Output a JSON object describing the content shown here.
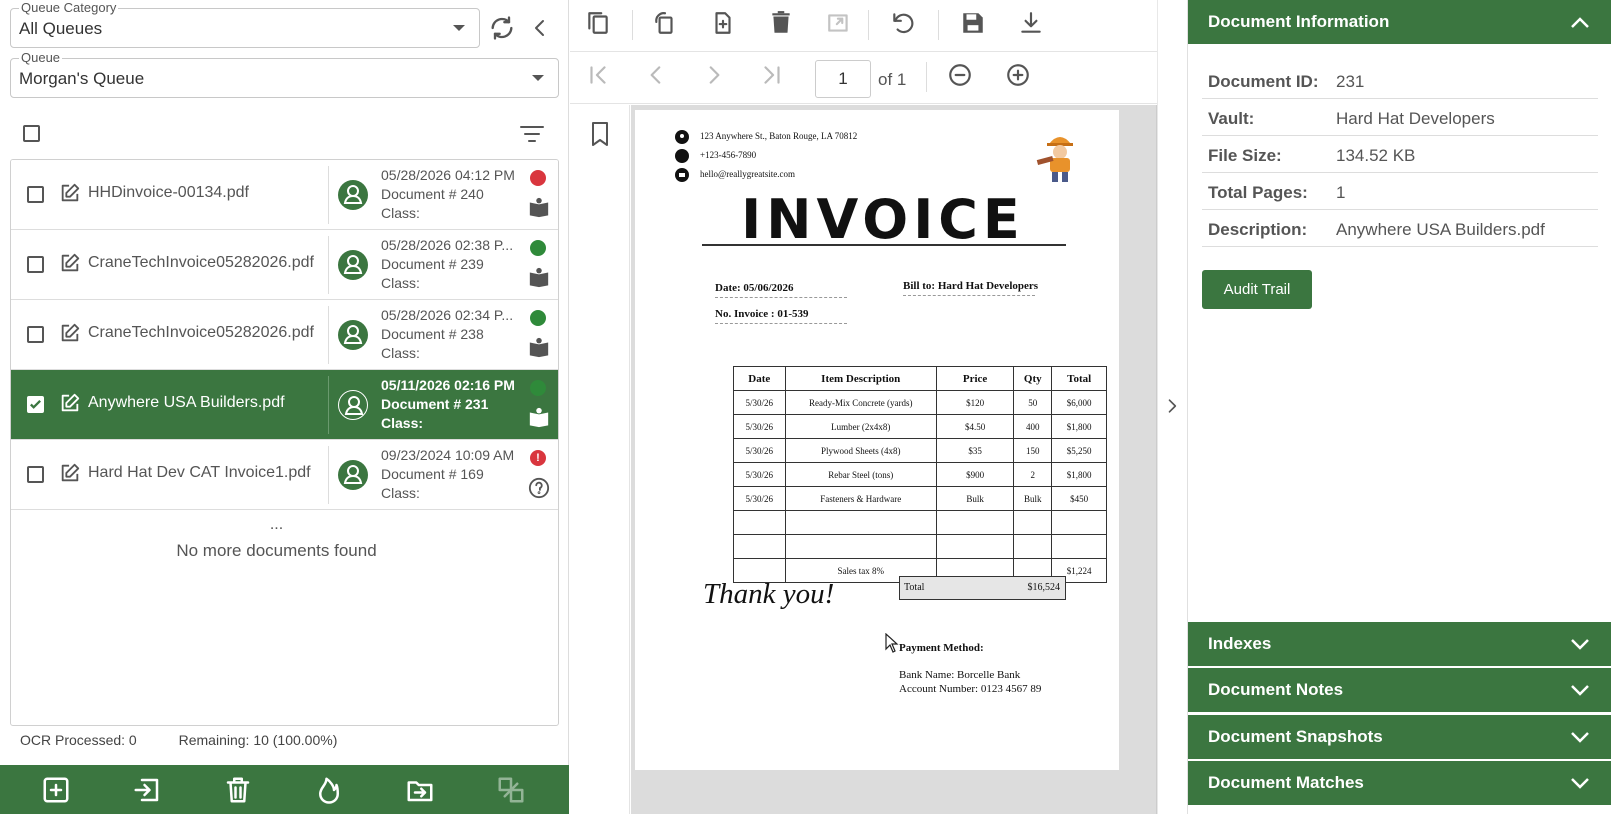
{
  "left": {
    "queue_category": {
      "label": "Queue Category",
      "value": "All Queues"
    },
    "queue": {
      "label": "Queue",
      "value": "Morgan's Queue"
    },
    "documents": [
      {
        "name": "HHDinvoice-00134.pdf",
        "date": "05/28/2026 04:12 PM",
        "doc": "Document # 240",
        "class": "Class:",
        "status": "red",
        "selected": false
      },
      {
        "name": "CraneTechInvoice05282026.pdf",
        "date": "05/28/2026 02:38 P...",
        "doc": "Document # 239",
        "class": "Class:",
        "status": "green",
        "selected": false
      },
      {
        "name": "CraneTechInvoice05282026.pdf",
        "date": "05/28/2026 02:34 P...",
        "doc": "Document # 238",
        "class": "Class:",
        "status": "green",
        "selected": false
      },
      {
        "name": "Anywhere USA Builders.pdf",
        "date": "05/11/2026 02:16 PM",
        "doc": "Document # 231",
        "class": "Class:",
        "status": "green",
        "selected": true
      },
      {
        "name": "Hard Hat Dev CAT Invoice1.pdf",
        "date": "09/23/2024 10:09 AM",
        "doc": "Document # 169",
        "class": "Class:",
        "status": "alert",
        "selected": false
      }
    ],
    "ellipsis": "...",
    "no_more": "No more documents found",
    "ocr_processed": "OCR Processed: 0",
    "remaining": "Remaining: 10 (100.00%)"
  },
  "viewer": {
    "page_current": "1",
    "page_total": "of 1"
  },
  "invoice": {
    "address": "123 Anywhere St., Baton Rouge, LA 70812",
    "phone": "+123-456-7890",
    "email": "hello@reallygreatsite.com",
    "title": "INVOICE",
    "date": "Date:  05/06/2026",
    "number": "No. Invoice : 01-539",
    "bill_to": "Bill to: Hard Hat Developers",
    "headers": [
      "Date",
      "Item Description",
      "Price",
      "Qty",
      "Total"
    ],
    "rows": [
      [
        "5/30/26",
        "Ready-Mix Concrete (yards)",
        "$120",
        "50",
        "$6,000"
      ],
      [
        "5/30/26",
        "Lumber (2x4x8)",
        "$4.50",
        "400",
        "$1,800"
      ],
      [
        "5/30/26",
        "Plywood Sheets (4x8)",
        "$35",
        "150",
        "$5,250"
      ],
      [
        "5/30/26",
        "Rebar Steel (tons)",
        "$900",
        "2",
        "$1,800"
      ],
      [
        "5/30/26",
        "Fasteners & Hardware",
        "Bulk",
        "Bulk",
        "$450"
      ],
      [
        "",
        "",
        "",
        "",
        ""
      ],
      [
        "",
        "",
        "",
        "",
        ""
      ],
      [
        "",
        "Sales tax 8%",
        "",
        "",
        "$1,224"
      ]
    ],
    "total_label": "Total",
    "total_value": "$16,524",
    "thanks": "Thank you!",
    "payment_method": "Payment Method:",
    "bank": "Bank Name: Borcelle Bank",
    "account": "Account Number: 0123 4567 89"
  },
  "right": {
    "doc_info_title": "Document Information",
    "fields": [
      {
        "k": "Document ID:",
        "v": "231"
      },
      {
        "k": "Vault:",
        "v": "Hard Hat Developers"
      },
      {
        "k": "File Size:",
        "v": "134.52 KB"
      },
      {
        "k": "Total Pages:",
        "v": "1"
      },
      {
        "k": "Description:",
        "v": "Anywhere USA Builders.pdf"
      }
    ],
    "audit_label": "Audit Trail",
    "sections": [
      "Indexes",
      "Document Notes",
      "Document Snapshots",
      "Document Matches"
    ]
  },
  "colors": {
    "brand": "#3b7640",
    "status_red": "#d9363e",
    "status_green": "#2f8a3a"
  }
}
